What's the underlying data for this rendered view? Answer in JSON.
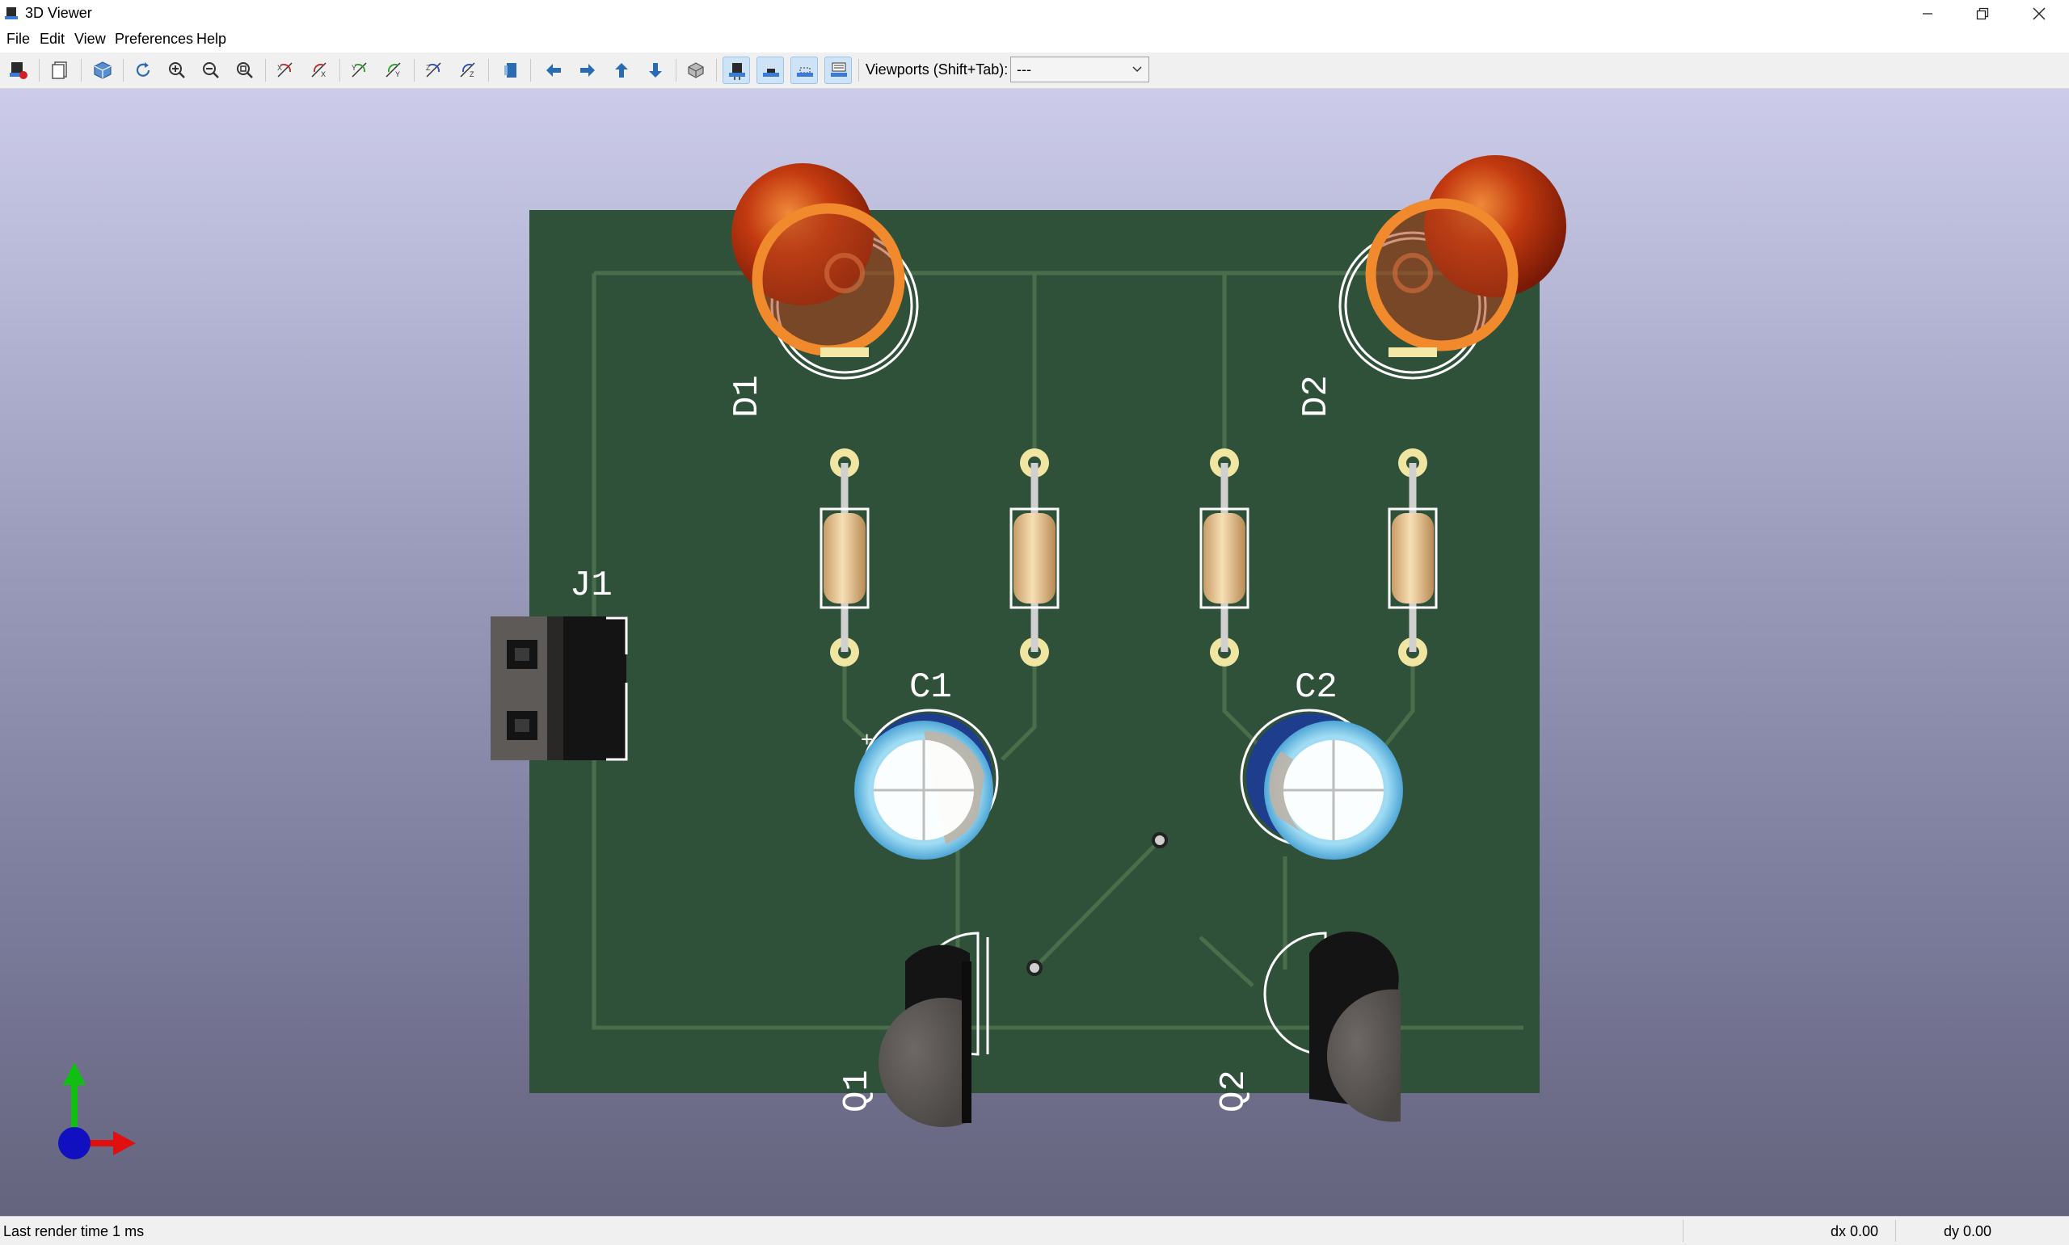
{
  "window": {
    "title": "3D Viewer",
    "minimize_icon": "minimize-icon",
    "maximize_icon": "restore-icon",
    "close_icon": "close-icon"
  },
  "menu": {
    "file": "File",
    "edit": "Edit",
    "view": "View",
    "preferences": "Preferences",
    "help": "Help"
  },
  "toolbar": {
    "tools": [
      {
        "name": "reload-board-icon"
      },
      {
        "name": "copy-image-icon"
      },
      {
        "name": "3d-render-icon"
      },
      {
        "name": "redraw-icon"
      },
      {
        "name": "zoom-in-icon"
      },
      {
        "name": "zoom-out-icon"
      },
      {
        "name": "zoom-fit-icon"
      },
      {
        "name": "rotate-x-cw-icon"
      },
      {
        "name": "rotate-x-ccw-icon"
      },
      {
        "name": "rotate-y-cw-icon"
      },
      {
        "name": "rotate-y-ccw-icon"
      },
      {
        "name": "rotate-z-cw-icon"
      },
      {
        "name": "rotate-z-ccw-icon"
      },
      {
        "name": "flip-board-icon"
      },
      {
        "name": "move-left-icon"
      },
      {
        "name": "move-right-icon"
      },
      {
        "name": "move-up-icon"
      },
      {
        "name": "move-down-icon"
      },
      {
        "name": "orthographic-icon"
      },
      {
        "name": "show-tht-icon"
      },
      {
        "name": "show-smd-icon"
      },
      {
        "name": "show-virtual-icon"
      },
      {
        "name": "show-not-in-posfile-icon"
      }
    ],
    "viewports_label": "Viewports (Shift+Tab):",
    "viewports_value": "---"
  },
  "board": {
    "references": {
      "d1": "D1",
      "d2": "D2",
      "j1": "J1",
      "c1": "C1",
      "c2": "C2",
      "q1": "Q1",
      "q2": "Q2"
    },
    "polarity_mark": "+",
    "colors": {
      "pcb": "#2f5139",
      "led": "#c33a10",
      "led_ring": "#f08a2c",
      "resistor": "#e7c69a",
      "pad": "#f0e6a2",
      "capacitor_ring": "#8fd4ee",
      "capacitor_body": "#1e3d8c",
      "transistor": "#5b5653",
      "connector": "#141414"
    }
  },
  "axes": {
    "x_color": "#e01010",
    "y_color": "#10c010",
    "z_color": "#1010c0"
  },
  "status": {
    "render_time": "Last render time 1 ms",
    "dx": "dx 0.00",
    "dy": "dy 0.00"
  }
}
